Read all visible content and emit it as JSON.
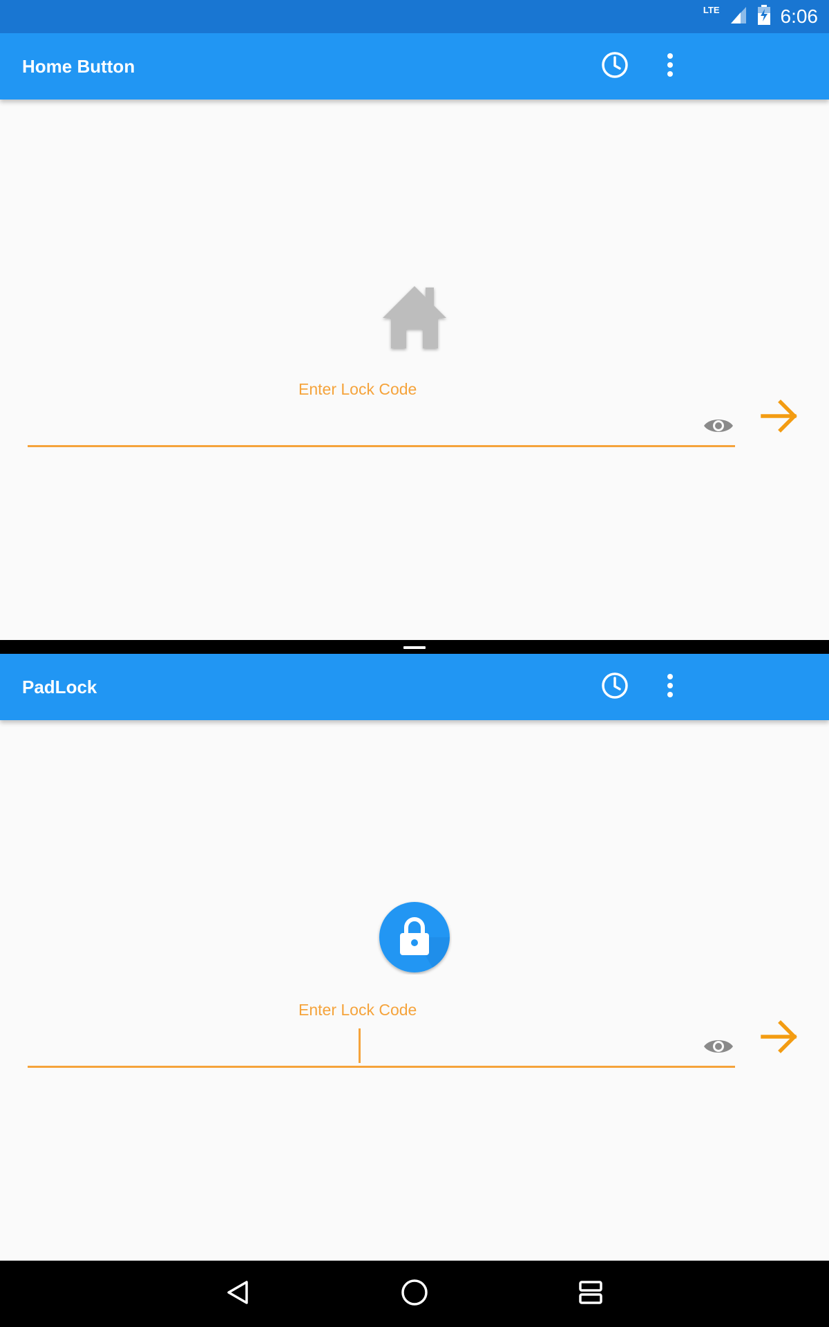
{
  "status_bar": {
    "network": "LTE",
    "time": "6:06"
  },
  "top_window": {
    "title": "Home Button",
    "icon": "home-icon",
    "field_label": "Enter Lock Code",
    "code_value": "",
    "actions": [
      "history-icon",
      "more-vert-icon"
    ]
  },
  "bottom_window": {
    "title": "PadLock",
    "icon": "padlock-icon",
    "field_label": "Enter Lock Code",
    "code_value": "",
    "actions": [
      "history-icon",
      "more-vert-icon"
    ]
  },
  "colors": {
    "status_bar": "#1976d2",
    "app_bar": "#2196f3",
    "accent": "#f5a33b",
    "go_arrow": "#f39c12",
    "eye_icon": "#8a8a8a",
    "home_icon": "#bdbdbd"
  },
  "navigation": [
    "back-icon",
    "home-circle-icon",
    "recents-icon"
  ]
}
